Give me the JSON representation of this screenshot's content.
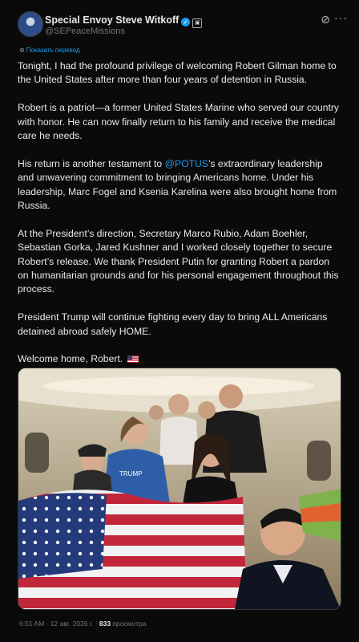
{
  "author": {
    "name": "Special Envoy Steve Witkoff",
    "handle": "@SEPeaceMissions"
  },
  "icons": {
    "avatar": "avatar-photo",
    "verified": "verified-badge-icon",
    "affiliation": "government-affiliation-icon",
    "grok": "grok-icon",
    "more": "more-options-icon",
    "translate": "globe-icon"
  },
  "translate_label": "Показать перевод",
  "tweet": {
    "p1": "Tonight, I had the profound privilege of welcoming Robert Gilman home to the United States after more than four years of detention in Russia.",
    "p2": "Robert is a patriot—a former United States Marine who served our country with honor. He can now finally return to his family and receive the medical care he needs.",
    "p3_a": "His return is another testament to ",
    "p3_mention": "@POTUS",
    "p3_b": "’s extraordinary leadership and unwavering commitment to bringing Americans home. Under his leadership, Marc Fogel and Ksenia Karelina were also brought home from Russia.",
    "p4": "At the President’s direction, Secretary Marco Rubio, Adam Boehler, Sebastian Gorka, Jared Kushner and I worked closely together to secure Robert’s release. We thank President Putin for granting Robert a pardon on humanitarian grounds and for his personal engagement throughout this process.",
    "p5": "President Trump will continue fighting every day to bring ALL Americans detained abroad safely HOME.",
    "p6": "Welcome home, Robert."
  },
  "photo": {
    "shirt_text": "TRUMP"
  },
  "meta": {
    "time": "6:51 AM",
    "sep1": " · ",
    "date": "12 авг. 2026 г.",
    "sep2": " · ",
    "views": "833",
    "views_label": " просмотра"
  },
  "colors": {
    "background": "#0a0a0a",
    "text": "#e7e9ea",
    "secondary": "#71767b",
    "link": "#1d9bf0"
  }
}
